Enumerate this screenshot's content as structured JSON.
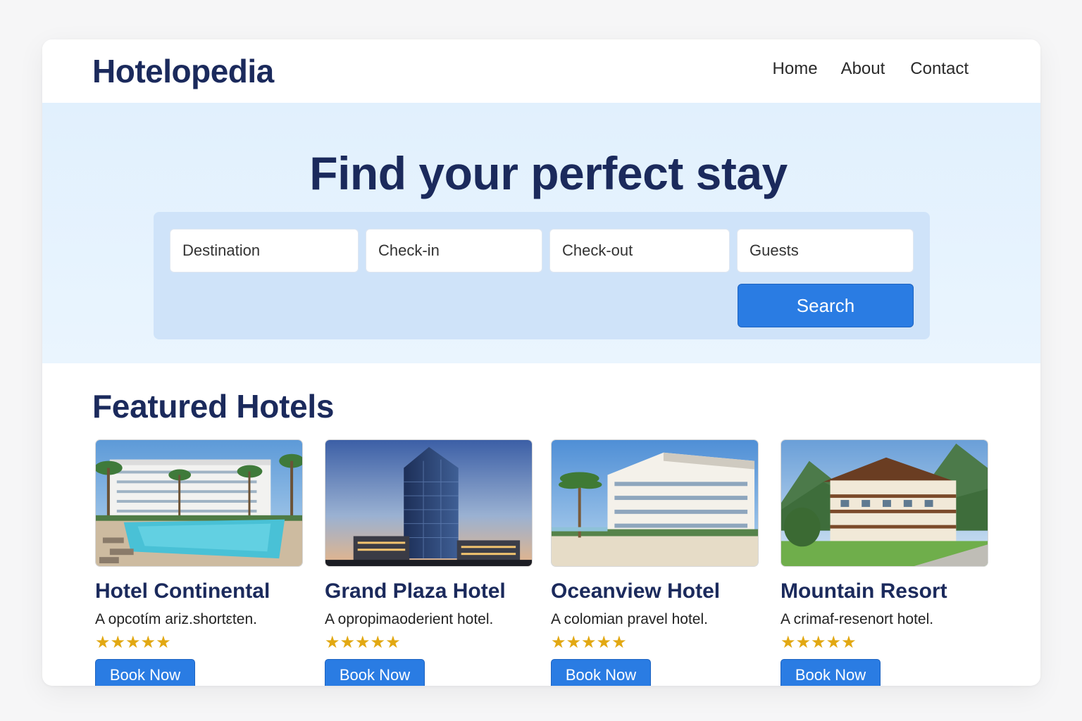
{
  "header": {
    "brand": "Hotelopedia",
    "nav": [
      "Home",
      "About",
      "Contact"
    ]
  },
  "hero": {
    "title": "Find your perfect stay",
    "search": {
      "destination_placeholder": "Destination",
      "checkin_placeholder": "Check-in",
      "checkout_placeholder": "Check-out",
      "guests_placeholder": "Guests",
      "button_label": "Search"
    }
  },
  "featured": {
    "title": "Featured Hotels",
    "hotels": [
      {
        "name": "Hotel Continental",
        "description": "A opcotím ariz.shortεten.",
        "stars": "★★★★★",
        "rating": 5,
        "button": "Book Now"
      },
      {
        "name": "Grand Plaza Hotel",
        "description": "A opropimaoderient hotel.",
        "stars": "★★★★★",
        "rating": 5,
        "button": "Book Now"
      },
      {
        "name": "Oceanview Hotel",
        "description": "A colomian pravel hotel.",
        "stars": "★★★★★",
        "rating": 5,
        "button": "Book Now"
      },
      {
        "name": "Mountain Resort",
        "description": "A crimaf-resenort hotel.",
        "stars": "★★★★★",
        "rating": 5,
        "button": "Book Now"
      }
    ]
  },
  "colors": {
    "brand": "#1b2a5c",
    "accent": "#2a7ce3",
    "hero_bg": "#e1f0fd",
    "search_panel": "#cfe3f9",
    "star": "#e2a812"
  }
}
